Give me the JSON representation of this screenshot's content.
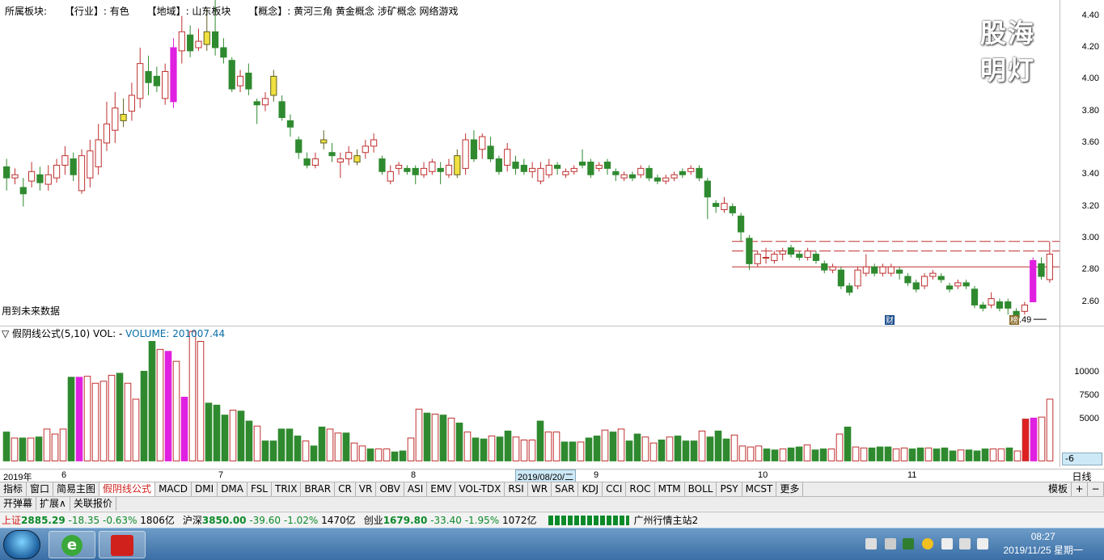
{
  "header": {
    "board_label": "所属板块:",
    "industry": "【行业】: 有色",
    "region": "【地域】: 山东板块",
    "concept": "【概念】: 黄河三角 黄金概念 涉矿概念 网络游戏"
  },
  "watermark": "股海明灯",
  "future_note": "用到未来数据",
  "annotations": {
    "low_price": "2.49",
    "badge_cai": "财",
    "badge_bang": "榜"
  },
  "price_axis": {
    "labels": [
      "4.40",
      "4.20",
      "4.00",
      "3.80",
      "3.60",
      "3.40",
      "3.20",
      "3.00",
      "2.80",
      "2.60"
    ]
  },
  "volume_panel": {
    "formula": "▽ 假阴线公式(5,10)",
    "vol_label": "VOL: -",
    "volume_value": "VOLUME: 201007.44",
    "axis_labels": [
      "10000",
      "7500",
      "5000"
    ],
    "axis_bottom": "-6"
  },
  "date_axis": {
    "labels": [
      "2019年",
      "6",
      "7",
      "8",
      "2019/08/20/二",
      "9",
      "10",
      "11"
    ],
    "period": "日线"
  },
  "tabs": {
    "main": [
      "指标",
      "窗口",
      "简易主图",
      "假阴线公式",
      "MACD",
      "DMI",
      "DMA",
      "FSL",
      "TRIX",
      "BRAR",
      "CR",
      "VR",
      "OBV",
      "ASI",
      "EMV",
      "VOL-TDX",
      "RSI",
      "WR",
      "SAR",
      "KDJ",
      "CCI",
      "ROC",
      "MTM",
      "BOLL",
      "PSY",
      "MCST",
      "更多"
    ],
    "right": [
      "模板",
      "+",
      "−"
    ],
    "second": [
      "开弹幕",
      "扩展∧",
      "关联报价"
    ]
  },
  "status": {
    "sh_name": "上证",
    "sh_value": "2885.29",
    "sh_chg": "-18.35",
    "sh_pct": "-0.63%",
    "sh_amt": "1806亿",
    "sz_name": "沪深",
    "sz_value": "3850.00",
    "sz_chg": "-39.60",
    "sz_pct": "-1.02%",
    "sz_amt": "1470亿",
    "cy_name": "创业",
    "cy_value": "1679.80",
    "cy_chg": "-33.40",
    "cy_pct": "-1.95%",
    "cy_amt": "1072亿",
    "server": "广州行情主站2"
  },
  "taskbar": {
    "time": "08:27",
    "date": "2019/11/25 星期一"
  },
  "chart_data": {
    "type": "candlestick",
    "ylim": [
      2.45,
      4.5
    ],
    "y_ticks": [
      2.6,
      2.8,
      3.0,
      3.2,
      3.4,
      3.6,
      3.8,
      4.0,
      4.2,
      4.4
    ],
    "candles": [
      [
        3.45,
        3.38,
        3.5,
        3.3
      ],
      [
        3.38,
        3.4,
        3.44,
        3.34
      ],
      [
        3.32,
        3.28,
        3.38,
        3.2
      ],
      [
        3.36,
        3.42,
        3.48,
        3.32
      ],
      [
        3.4,
        3.35,
        3.45,
        3.3
      ],
      [
        3.34,
        3.4,
        3.46,
        3.3
      ],
      [
        3.38,
        3.46,
        3.5,
        3.35
      ],
      [
        3.46,
        3.52,
        3.58,
        3.4
      ],
      [
        3.5,
        3.4,
        3.54,
        3.36
      ],
      [
        3.3,
        3.52,
        3.56,
        3.28
      ],
      [
        3.38,
        3.55,
        3.62,
        3.32
      ],
      [
        3.45,
        3.62,
        3.72,
        3.4
      ],
      [
        3.6,
        3.72,
        3.86,
        3.55
      ],
      [
        3.68,
        3.82,
        3.92,
        3.6
      ],
      [
        3.78,
        3.74,
        3.88,
        3.7
      ],
      [
        3.8,
        3.9,
        3.98,
        3.74
      ],
      [
        3.88,
        4.1,
        4.2,
        3.82
      ],
      [
        4.05,
        3.98,
        4.15,
        3.9
      ],
      [
        4.02,
        3.96,
        4.08,
        3.92
      ],
      [
        3.88,
        4.05,
        4.1,
        3.84
      ],
      [
        3.86,
        4.2,
        4.26,
        3.82
      ],
      [
        4.18,
        4.3,
        4.4,
        4.1
      ],
      [
        4.28,
        4.18,
        4.34,
        4.14
      ],
      [
        4.2,
        4.24,
        4.32,
        4.18
      ],
      [
        4.22,
        4.3,
        4.45,
        4.18
      ],
      [
        4.3,
        4.2,
        4.52,
        4.15
      ],
      [
        4.2,
        4.14,
        4.26,
        4.1
      ],
      [
        4.12,
        3.94,
        4.14,
        3.92
      ],
      [
        3.96,
        4.02,
        4.06,
        3.92
      ],
      [
        4.04,
        3.94,
        4.1,
        3.9
      ],
      [
        3.86,
        3.84,
        3.88,
        3.72
      ],
      [
        3.84,
        3.88,
        3.92,
        3.8
      ],
      [
        4.02,
        3.9,
        4.06,
        3.86
      ],
      [
        3.86,
        3.76,
        3.9,
        3.74
      ],
      [
        3.74,
        3.7,
        3.78,
        3.64
      ],
      [
        3.62,
        3.54,
        3.64,
        3.5
      ],
      [
        3.5,
        3.46,
        3.54,
        3.44
      ],
      [
        3.46,
        3.5,
        3.54,
        3.44
      ],
      [
        3.62,
        3.6,
        3.68,
        3.56
      ],
      [
        3.54,
        3.52,
        3.6,
        3.48
      ],
      [
        3.48,
        3.5,
        3.54,
        3.38
      ],
      [
        3.5,
        3.54,
        3.58,
        3.46
      ],
      [
        3.52,
        3.48,
        3.56,
        3.46
      ],
      [
        3.54,
        3.58,
        3.62,
        3.5
      ],
      [
        3.58,
        3.62,
        3.66,
        3.54
      ],
      [
        3.5,
        3.42,
        3.52,
        3.4
      ],
      [
        3.36,
        3.42,
        3.46,
        3.34
      ],
      [
        3.44,
        3.46,
        3.48,
        3.4
      ],
      [
        3.44,
        3.42,
        3.46,
        3.4
      ],
      [
        3.44,
        3.4,
        3.46,
        3.34
      ],
      [
        3.4,
        3.44,
        3.48,
        3.38
      ],
      [
        3.42,
        3.48,
        3.5,
        3.4
      ],
      [
        3.44,
        3.42,
        3.48,
        3.34
      ],
      [
        3.4,
        3.46,
        3.5,
        3.38
      ],
      [
        3.52,
        3.4,
        3.56,
        3.38
      ],
      [
        3.44,
        3.62,
        3.66,
        3.4
      ],
      [
        3.62,
        3.5,
        3.68,
        3.48
      ],
      [
        3.56,
        3.64,
        3.66,
        3.5
      ],
      [
        3.58,
        3.5,
        3.64,
        3.48
      ],
      [
        3.5,
        3.42,
        3.52,
        3.4
      ],
      [
        3.46,
        3.56,
        3.6,
        3.42
      ],
      [
        3.48,
        3.44,
        3.52,
        3.4
      ],
      [
        3.46,
        3.42,
        3.5,
        3.4
      ],
      [
        3.42,
        3.44,
        3.48,
        3.38
      ],
      [
        3.36,
        3.44,
        3.48,
        3.34
      ],
      [
        3.4,
        3.46,
        3.5,
        3.38
      ],
      [
        3.46,
        3.44,
        3.48,
        3.4
      ],
      [
        3.4,
        3.42,
        3.44,
        3.38
      ],
      [
        3.42,
        3.44,
        3.46,
        3.4
      ],
      [
        3.48,
        3.46,
        3.56,
        3.44
      ],
      [
        3.48,
        3.4,
        3.5,
        3.38
      ],
      [
        3.44,
        3.46,
        3.48,
        3.42
      ],
      [
        3.48,
        3.44,
        3.5,
        3.4
      ],
      [
        3.42,
        3.4,
        3.44,
        3.36
      ],
      [
        3.38,
        3.4,
        3.42,
        3.36
      ],
      [
        3.4,
        3.38,
        3.42,
        3.36
      ],
      [
        3.4,
        3.44,
        3.46,
        3.38
      ],
      [
        3.44,
        3.38,
        3.46,
        3.36
      ],
      [
        3.38,
        3.36,
        3.4,
        3.34
      ],
      [
        3.36,
        3.38,
        3.4,
        3.34
      ],
      [
        3.38,
        3.4,
        3.42,
        3.36
      ],
      [
        3.42,
        3.4,
        3.44,
        3.38
      ],
      [
        3.42,
        3.44,
        3.46,
        3.4
      ],
      [
        3.44,
        3.38,
        3.46,
        3.36
      ],
      [
        3.36,
        3.26,
        3.38,
        3.12
      ],
      [
        3.22,
        3.2,
        3.24,
        3.16
      ],
      [
        3.18,
        3.22,
        3.26,
        3.16
      ],
      [
        3.2,
        3.16,
        3.22,
        3.14
      ],
      [
        3.14,
        3.04,
        3.16,
        2.98
      ],
      [
        3.0,
        2.84,
        3.02,
        2.8
      ],
      [
        2.84,
        2.9,
        2.92,
        2.82
      ],
      [
        2.88,
        2.88,
        2.94,
        2.84
      ],
      [
        2.86,
        2.9,
        2.92,
        2.84
      ],
      [
        2.9,
        2.92,
        2.94,
        2.86
      ],
      [
        2.94,
        2.9,
        2.96,
        2.88
      ],
      [
        2.9,
        2.88,
        2.92,
        2.86
      ],
      [
        2.88,
        2.92,
        2.94,
        2.86
      ],
      [
        2.9,
        2.86,
        2.92,
        2.84
      ],
      [
        2.84,
        2.8,
        2.86,
        2.78
      ],
      [
        2.8,
        2.82,
        2.84,
        2.78
      ],
      [
        2.8,
        2.7,
        2.82,
        2.68
      ],
      [
        2.7,
        2.66,
        2.72,
        2.64
      ],
      [
        2.7,
        2.8,
        2.82,
        2.68
      ],
      [
        2.78,
        2.82,
        2.9,
        2.76
      ],
      [
        2.82,
        2.78,
        2.84,
        2.76
      ],
      [
        2.78,
        2.82,
        2.84,
        2.76
      ],
      [
        2.78,
        2.82,
        2.84,
        2.76
      ],
      [
        2.8,
        2.78,
        2.82,
        2.74
      ],
      [
        2.76,
        2.72,
        2.78,
        2.7
      ],
      [
        2.72,
        2.68,
        2.74,
        2.66
      ],
      [
        2.7,
        2.76,
        2.78,
        2.68
      ],
      [
        2.76,
        2.78,
        2.8,
        2.74
      ],
      [
        2.76,
        2.74,
        2.78,
        2.72
      ],
      [
        2.7,
        2.68,
        2.72,
        2.66
      ],
      [
        2.7,
        2.72,
        2.74,
        2.68
      ],
      [
        2.72,
        2.7,
        2.74,
        2.68
      ],
      [
        2.68,
        2.58,
        2.7,
        2.56
      ],
      [
        2.58,
        2.56,
        2.6,
        2.54
      ],
      [
        2.58,
        2.62,
        2.66,
        2.56
      ],
      [
        2.6,
        2.56,
        2.62,
        2.54
      ],
      [
        2.6,
        2.56,
        2.62,
        2.52
      ],
      [
        2.54,
        2.5,
        2.56,
        2.49
      ],
      [
        2.54,
        2.58,
        2.6,
        2.52
      ],
      [
        2.6,
        2.86,
        2.88,
        2.6
      ],
      [
        2.84,
        2.76,
        2.88,
        2.74
      ],
      [
        2.74,
        2.9,
        2.98,
        2.72
      ]
    ],
    "volumes": [
      2900,
      2300,
      2300,
      2300,
      2400,
      3200,
      2700,
      3200,
      8400,
      8400,
      8500,
      7800,
      8000,
      8600,
      8800,
      7800,
      6200,
      9000,
      12000,
      11200,
      11000,
      10000,
      6400,
      13000,
      12000,
      5800,
      5600,
      4600,
      5100,
      5000,
      4000,
      3500,
      2000,
      2000,
      3200,
      3200,
      2500,
      2000,
      1500,
      3400,
      3200,
      2800,
      2800,
      1800,
      1500,
      1200,
      1200,
      1200,
      900,
      1000,
      2300,
      5200,
      4800,
      4700,
      4600,
      4300,
      3800,
      2900,
      2300,
      2200,
      2500,
      2400,
      3000,
      2400,
      2100,
      2100,
      4000,
      2900,
      2900,
      1900,
      1900,
      1900,
      2300,
      2500,
      3100,
      2900,
      3200,
      2000,
      2700,
      2400,
      1800,
      2100,
      2400,
      2500,
      2000,
      2000,
      3000,
      2400,
      3000,
      2200,
      2600,
      1500,
      1400,
      1500,
      1200,
      1100,
      1200,
      1300,
      1400,
      1600,
      1100,
      1200,
      1200,
      2700,
      3400,
      1400,
      1300,
      1300,
      1400,
      1400,
      1200,
      1300,
      1200,
      1300,
      1300,
      1200,
      1300,
      1000,
      1100,
      1100,
      1000,
      1200,
      1200,
      1200,
      1300,
      1000,
      4200,
      4300,
      4400,
      6200
    ],
    "vol_ylim": [
      -700,
      13500
    ],
    "vol_ticks": [
      5000,
      7500,
      10000
    ]
  }
}
